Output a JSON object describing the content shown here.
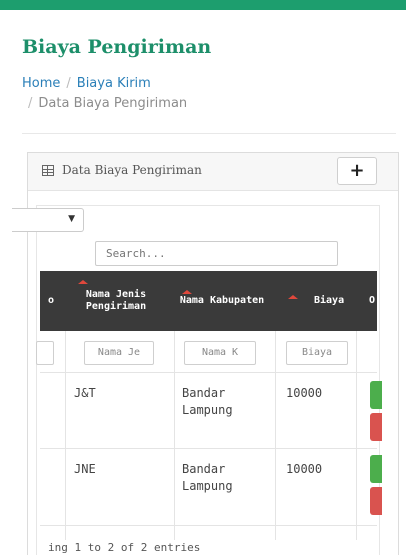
{
  "page": {
    "title": "Biaya Pengiriman",
    "accent_color": "#1d9e6e",
    "breadcrumb": {
      "home": "Home",
      "separator": "/",
      "parent": "Biaya Kirim",
      "current": "Data Biaya Pengiriman"
    }
  },
  "panel": {
    "title": "Data Biaya Pengiriman",
    "title_icon": "table-icon",
    "add_button_label": "+",
    "add_button_icon": "plus-icon"
  },
  "table": {
    "search_placeholder": "Search...",
    "columns": [
      {
        "cut_label": "o"
      },
      {
        "label": "Nama Jenis Pengiriman"
      },
      {
        "label": "Nama Kabupaten"
      },
      {
        "label": "Biaya"
      },
      {
        "cut_label": "O"
      }
    ],
    "filters": {
      "jenis": "Nama Je",
      "kabupaten": "Nama K",
      "biaya": "Biaya"
    },
    "rows": [
      {
        "jenis": "J&T",
        "kabupaten": "Bandar Lampung",
        "biaya": "10000"
      },
      {
        "jenis": "JNE",
        "kabupaten": "Bandar Lampung",
        "biaya": "10000"
      }
    ],
    "info": "ing 1 to 2 of 2 entries",
    "colors": {
      "header_bg": "#3a3a3a",
      "sort_indicator": "#e0483c",
      "edit": "#4cae4c",
      "delete": "#d9534f"
    }
  }
}
